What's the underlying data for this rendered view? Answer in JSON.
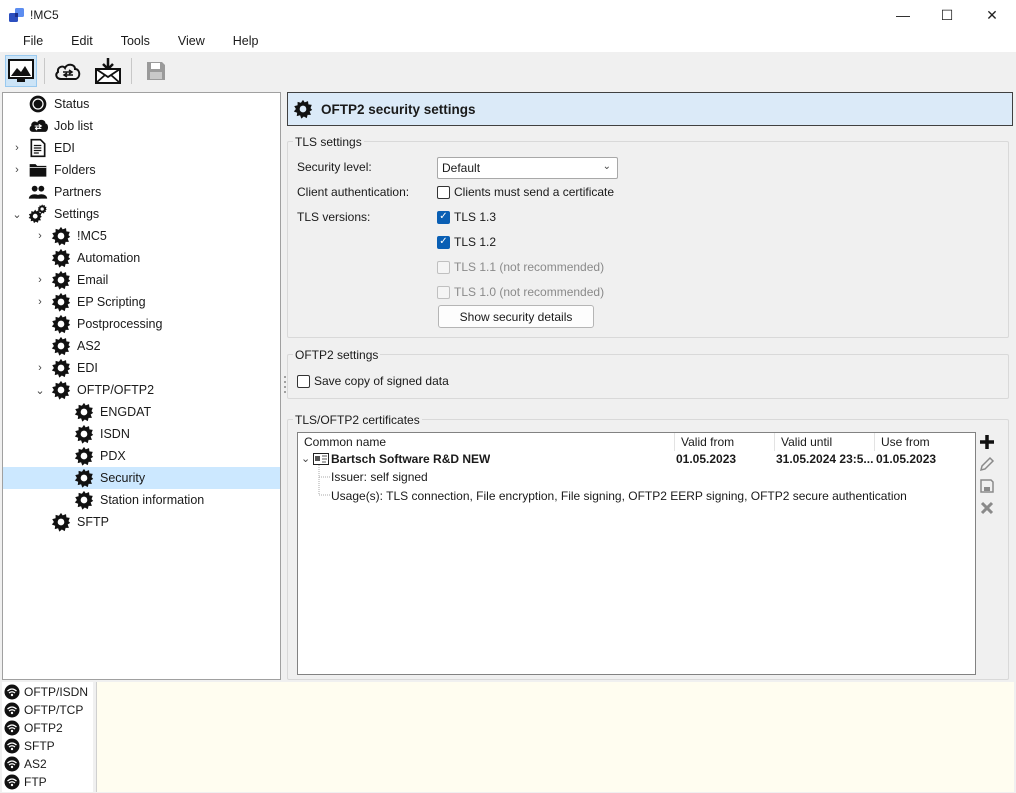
{
  "window": {
    "title": "!MC5",
    "minimize": "—",
    "maximize": "☐",
    "close": "✕"
  },
  "menu": [
    "File",
    "Edit",
    "Tools",
    "View",
    "Help"
  ],
  "toolbar": {
    "items": [
      "monitor-icon",
      "cloud-sync-icon",
      "mail-download-icon",
      "save-icon"
    ]
  },
  "tree": {
    "items": [
      {
        "label": "Status",
        "icon": "status-icon",
        "level": 0,
        "chevron": ""
      },
      {
        "label": "Job list",
        "icon": "cloud-icon",
        "level": 0,
        "chevron": ""
      },
      {
        "label": "EDI",
        "icon": "document-icon",
        "level": 0,
        "chevron": "›"
      },
      {
        "label": "Folders",
        "icon": "folder-icon",
        "level": 0,
        "chevron": "›"
      },
      {
        "label": "Partners",
        "icon": "people-icon",
        "level": 0,
        "chevron": ""
      },
      {
        "label": "Settings",
        "icon": "gears-icon",
        "level": 0,
        "chevron": "⌄"
      },
      {
        "label": "!MC5",
        "icon": "gear-icon",
        "level": 1,
        "chevron": "›"
      },
      {
        "label": "Automation",
        "icon": "gear-icon",
        "level": 1,
        "chevron": ""
      },
      {
        "label": "Email",
        "icon": "gear-icon",
        "level": 1,
        "chevron": "›"
      },
      {
        "label": "EP Scripting",
        "icon": "gear-icon",
        "level": 1,
        "chevron": "›"
      },
      {
        "label": "Postprocessing",
        "icon": "gear-icon",
        "level": 1,
        "chevron": ""
      },
      {
        "label": "AS2",
        "icon": "gear-icon",
        "level": 1,
        "chevron": ""
      },
      {
        "label": "EDI",
        "icon": "gear-icon",
        "level": 1,
        "chevron": "›"
      },
      {
        "label": "OFTP/OFTP2",
        "icon": "gear-icon",
        "level": 1,
        "chevron": "⌄"
      },
      {
        "label": "ENGDAT",
        "icon": "gear-icon",
        "level": 2,
        "chevron": ""
      },
      {
        "label": "ISDN",
        "icon": "gear-icon",
        "level": 2,
        "chevron": ""
      },
      {
        "label": "PDX",
        "icon": "gear-icon",
        "level": 2,
        "chevron": ""
      },
      {
        "label": "Security",
        "icon": "gear-icon",
        "level": 2,
        "chevron": "",
        "selected": true
      },
      {
        "label": "Station information",
        "icon": "gear-icon",
        "level": 2,
        "chevron": ""
      },
      {
        "label": "SFTP",
        "icon": "gear-icon",
        "level": 1,
        "chevron": ""
      }
    ]
  },
  "header": {
    "title": "OFTP2 security settings"
  },
  "tls": {
    "group_title": "TLS settings",
    "security_level_label": "Security level:",
    "security_level_value": "Default",
    "client_auth_label": "Client authentication:",
    "client_auth_checkbox": "Clients must send a certificate",
    "tls_versions_label": "TLS versions:",
    "versions": [
      {
        "label": "TLS 1.3",
        "checked": true,
        "disabled": false
      },
      {
        "label": "TLS 1.2",
        "checked": true,
        "disabled": false
      },
      {
        "label": "TLS 1.1 (not recommended)",
        "checked": false,
        "disabled": true
      },
      {
        "label": "TLS 1.0 (not recommended)",
        "checked": false,
        "disabled": true
      }
    ],
    "details_button": "Show security details"
  },
  "oftp2": {
    "group_title": "OFTP2 settings",
    "save_copy_label": "Save copy of signed data"
  },
  "certs": {
    "group_title": "TLS/OFTP2 certificates",
    "columns": [
      "Common name",
      "Valid from",
      "Valid until",
      "Use from"
    ],
    "row": {
      "name": "Bartsch Software R&D NEW",
      "valid_from": "01.05.2023",
      "valid_until": "31.05.2024 23:5...",
      "use_from": "01.05.2023",
      "issuer": "Issuer: self signed",
      "usages": "Usage(s): TLS connection, File encryption, File signing, OFTP2 EERP signing, OFTP2 secure authentication"
    }
  },
  "status_list": [
    "OFTP/ISDN",
    "OFTP/TCP",
    "OFTP2",
    "SFTP",
    "AS2",
    "FTP"
  ],
  "colors": {
    "accent": "#0a5fb4",
    "selection": "#cce8ff",
    "header_bg": "#dbeaf8",
    "log_bg": "#fffdf0"
  }
}
